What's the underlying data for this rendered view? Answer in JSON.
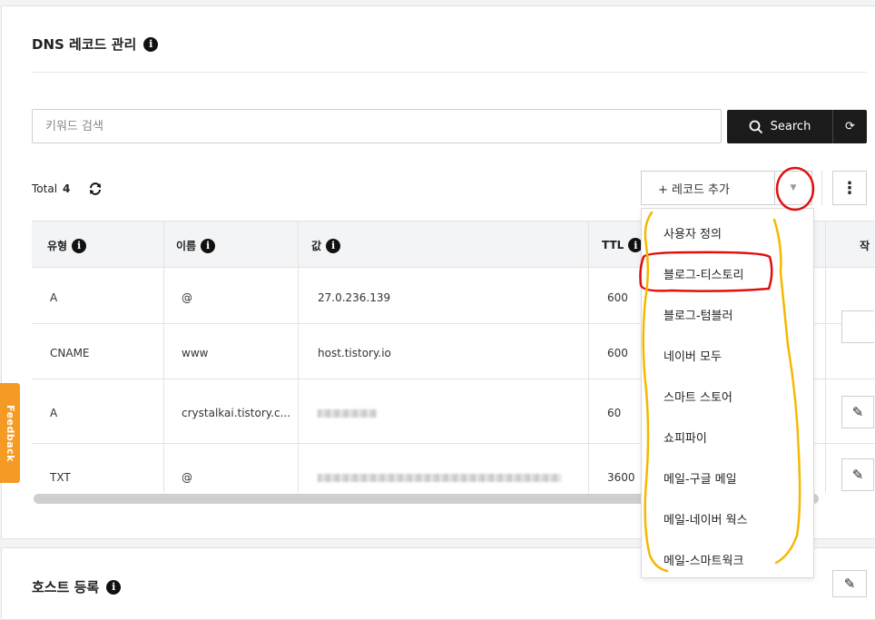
{
  "section": {
    "title": "DNS 레코드 관리",
    "info_icon": "i"
  },
  "search": {
    "placeholder": "키워드 검색",
    "button_label": "Search",
    "reset_icon": "⟳"
  },
  "toolbar": {
    "total_label": "Total",
    "total_count": "4",
    "add_record_label": "+ 레코드 추가",
    "dropdown_icon": "▼",
    "more_icon": "⋮"
  },
  "table": {
    "columns": [
      "유형",
      "이름",
      "값",
      "TTL",
      "작"
    ],
    "rows": [
      {
        "type": "A",
        "name": "@",
        "value": "27.0.236.139",
        "ttl": "600"
      },
      {
        "type": "CNAME",
        "name": "www",
        "value": "host.tistory.io",
        "ttl": "600"
      },
      {
        "type": "A",
        "name": "crystalkai.tistory.c...",
        "value": "",
        "ttl": "60"
      },
      {
        "type": "TXT",
        "name": "@",
        "value": "",
        "ttl": "3600"
      }
    ]
  },
  "dropdown_menu": {
    "items": [
      "사용자 정의",
      "블로그-티스토리",
      "블로그-텀블러",
      "네이버 모두",
      "스마트 스토어",
      "쇼피파이",
      "메일-구글 메일",
      "메일-네이버 웍스",
      "메일-스마트웍크"
    ]
  },
  "feedback": {
    "label": "Feedback"
  },
  "host_section": {
    "title": "호스트 등록"
  },
  "colors": {
    "primary_dark": "#1b1b1b",
    "feedback": "#f59b25",
    "annotation_red": "#e01010",
    "annotation_yellow": "#f5b800"
  }
}
